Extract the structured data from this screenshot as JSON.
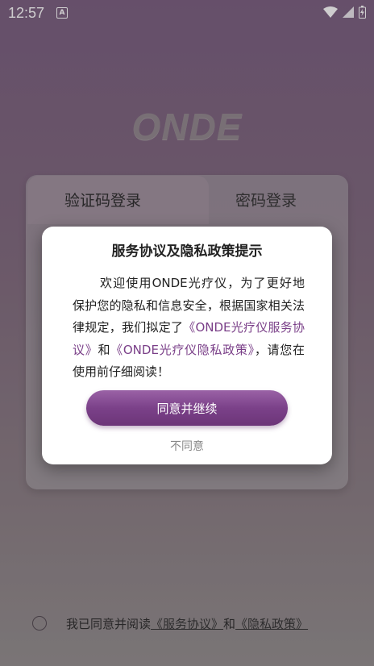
{
  "status_bar": {
    "time": "12:57",
    "a_badge": "A"
  },
  "logo": "ONDE",
  "tabs": [
    {
      "label": "验证码登录"
    },
    {
      "label": "密码登录"
    }
  ],
  "dialog": {
    "title": "服务协议及隐私政策提示",
    "body_part1": "欢迎使用ONDE光疗仪，为了更好地保护您的隐私和信息安全，根据国家相关法律规定，我们拟定了",
    "link_service": "《ONDE光疗仪服务协议》",
    "body_and": "和",
    "link_privacy": "《ONDE光疗仪隐私政策》",
    "body_part2": "，请您在使用前仔细阅读！",
    "agree_button": "同意并继续",
    "disagree_button": "不同意"
  },
  "agreement": {
    "prefix": "我已同意并阅读",
    "service_link": "《服务协议》",
    "and": "和",
    "privacy_link": "《隐私政策》",
    "checked": false
  },
  "colors": {
    "accent": "#7b4189",
    "link": "#7a3f88"
  }
}
